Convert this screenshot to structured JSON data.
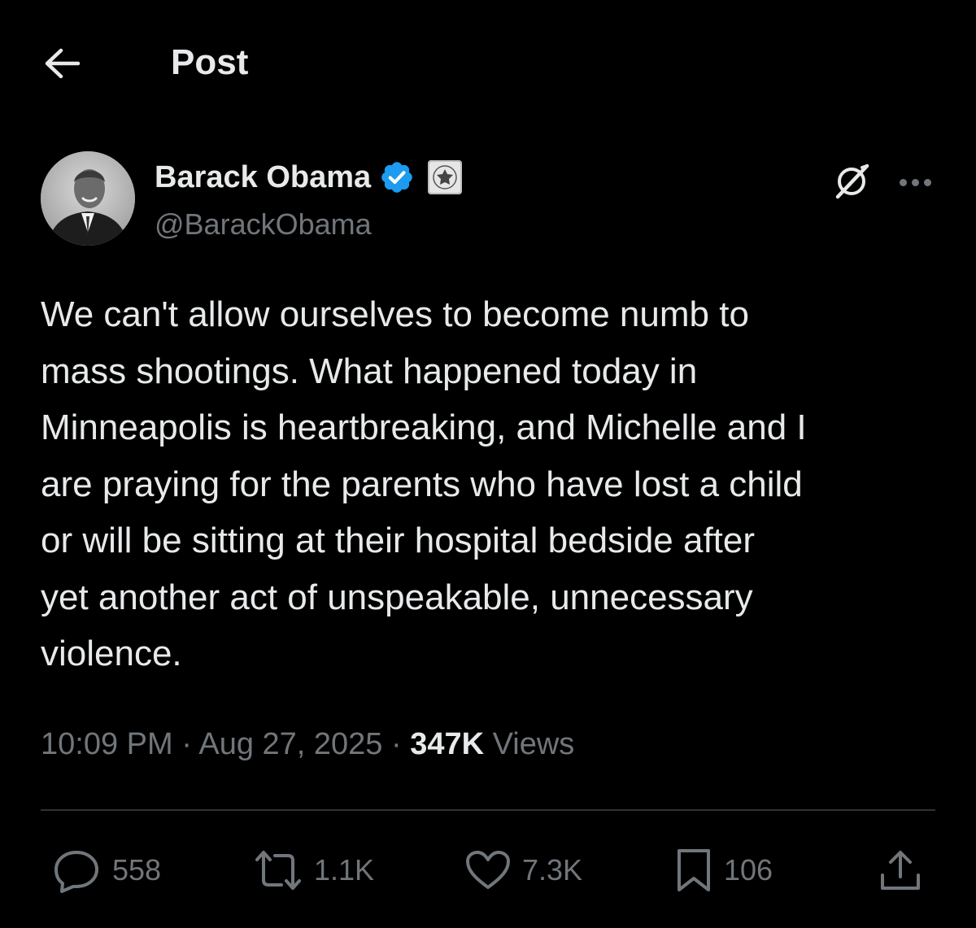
{
  "header": {
    "title": "Post"
  },
  "author": {
    "name": "Barack Obama",
    "handle": "@BarackObama"
  },
  "post": {
    "text": "We can't allow ourselves to become numb to\nmass shootings. What happened today in\nMinneapolis is heartbreaking, and Michelle and I\nare praying for the parents who have lost a child\nor will be sitting at their hospital bedside after\nyet another act of unspeakable, unnecessary\nviolence.",
    "time": "10:09 PM",
    "date": "Aug 27, 2025",
    "views_count": "347K",
    "views_label": "Views"
  },
  "actions": {
    "replies": "558",
    "reposts": "1.1K",
    "likes": "7.3K",
    "bookmarks": "106"
  },
  "colors": {
    "background": "#000000",
    "text_primary": "#e7e9ea",
    "text_secondary": "#71767b",
    "divider": "#2f3336",
    "verified_blue": "#1d9bf0"
  },
  "icons": {
    "back": "arrow-left-icon",
    "verified": "verified-badge-icon",
    "affiliation": "government-seal-icon",
    "grok": "grok-icon",
    "more": "more-horizontal-icon",
    "reply": "reply-icon",
    "repost": "repost-icon",
    "like": "heart-icon",
    "bookmark": "bookmark-icon",
    "share": "share-icon"
  }
}
